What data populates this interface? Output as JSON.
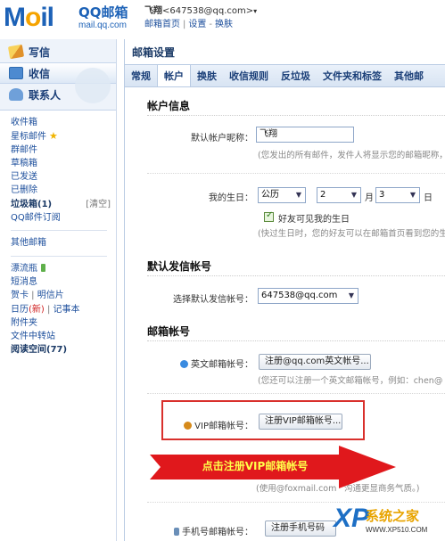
{
  "header": {
    "logo_main": "M",
    "logo_o": "o",
    "logo_il": "il",
    "logo_qq": "QQ邮箱",
    "logo_domain": "mail.qq.com",
    "user_name": "飞翔",
    "user_email": "<647538@qq.com>",
    "links": [
      "邮箱首页",
      "设置",
      "换肤"
    ]
  },
  "leftnav": {
    "top_buttons": [
      {
        "label": "写信",
        "icon": "pencil-icon"
      },
      {
        "label": "收信",
        "icon": "inbox-icon"
      },
      {
        "label": "联系人",
        "icon": "contacts-icon"
      }
    ],
    "folders": [
      {
        "label": "收件箱"
      },
      {
        "label": "星标邮件",
        "star": "★"
      },
      {
        "label": "群邮件"
      },
      {
        "label": "草稿箱"
      },
      {
        "label": "已发送"
      },
      {
        "label": "已删除"
      },
      {
        "label": "垃圾箱(1)",
        "clear": "[清空]",
        "bold": true
      },
      {
        "label": "QQ邮件订阅"
      }
    ],
    "other_mailbox": "其他邮箱",
    "extras": {
      "drift_bottle": "漂流瓶",
      "sms": "短消息",
      "greeting_card": "贺卡",
      "postcard": "明信片",
      "calendar": "日历",
      "calendar_badge": "(新)",
      "notebook": "记事本",
      "attachments": "附件夹",
      "file_transfer": "文件中转站",
      "reading_space": "阅读空间(77)"
    }
  },
  "content": {
    "title": "邮箱设置",
    "tabs": [
      "常规",
      "帐户",
      "换肤",
      "收信规则",
      "反垃圾",
      "文件夹和标签",
      "其他邮"
    ],
    "active_tab": 1,
    "section_account": "帐户信息",
    "nickname_label": "默认帐户昵称：",
    "nickname_value": "飞翔",
    "nickname_hint": "(您发出的所有邮件，发件人将显示您的邮箱昵称，",
    "birthday_label": "我的生日：",
    "calendar_type": "公历",
    "month": "2",
    "month_unit": "月",
    "day": "3",
    "day_unit": "日",
    "friends_visible_label": "好友可见我的生日",
    "birthday_hint": "(快过生日时，您的好友可以在邮箱首页看到您的生",
    "section_sender": "默认发信帐号",
    "sender_label": "选择默认发信帐号：",
    "sender_value": "647538@qq.com",
    "section_mailbox": "邮箱帐号",
    "english_label": "英文邮箱帐号：",
    "english_button": "注册@qq.com英文帐号...",
    "english_hint": "(您还可以注册一个英文邮箱帐号，例如：chen@",
    "vip_label": "VIP邮箱帐号：",
    "vip_button": "注册VIP邮箱帐号...",
    "foxmail_hint": "(使用@foxmail.com",
    "foxmail_hint2": "沟通更显商务气质。)",
    "mobile_label": "手机号邮箱帐号：",
    "mobile_button": "注册手机号码",
    "arrow_text": "点击注册VIP邮箱帐号",
    "arrow_color": "#e0181c"
  },
  "watermark": {
    "xp": "XP",
    "name": "系统之家",
    "url": "WWW.XP510.COM"
  }
}
